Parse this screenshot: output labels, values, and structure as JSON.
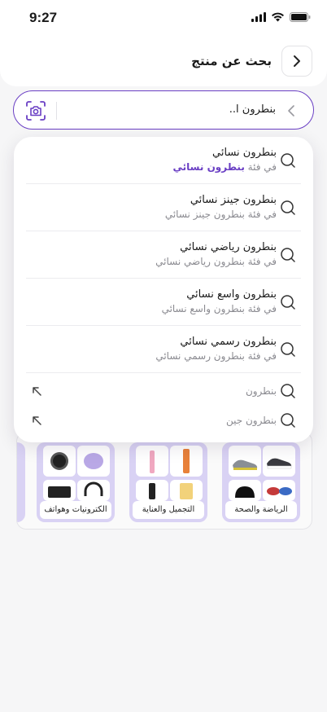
{
  "status": {
    "time": "9:27"
  },
  "header": {
    "title": "بحث عن منتج"
  },
  "search": {
    "value": "بنطرون ا.."
  },
  "suggestions": [
    {
      "title": "بنطرون نسائي",
      "prefix": "في فئة",
      "category": "بنطرون نسائي"
    },
    {
      "title": "بنطرون جينز نسائي",
      "subtitle": "في فئة بنطرون جينز نسائي"
    },
    {
      "title": "بنطرون رياضي نسائي",
      "subtitle": "في فئة بنطرون رياضي نسائي"
    },
    {
      "title": "بنطرون واسع نسائي",
      "subtitle": "في فئة بنطرون واسع نسائي"
    },
    {
      "title": "بنطرون رسمي نسائي",
      "subtitle": "في فئة بنطرون رسمي نسائي"
    }
  ],
  "recent": [
    {
      "text": "بنطرون"
    },
    {
      "text": "بنطرون جين"
    }
  ],
  "categories": [
    {
      "label": "الرياضة والصحة"
    },
    {
      "label": "التجميل والعناية"
    },
    {
      "label": "الكترونيات وهواتف"
    }
  ],
  "colors": {
    "accent": "#6a3fc4",
    "card": "#d9d2f4"
  }
}
